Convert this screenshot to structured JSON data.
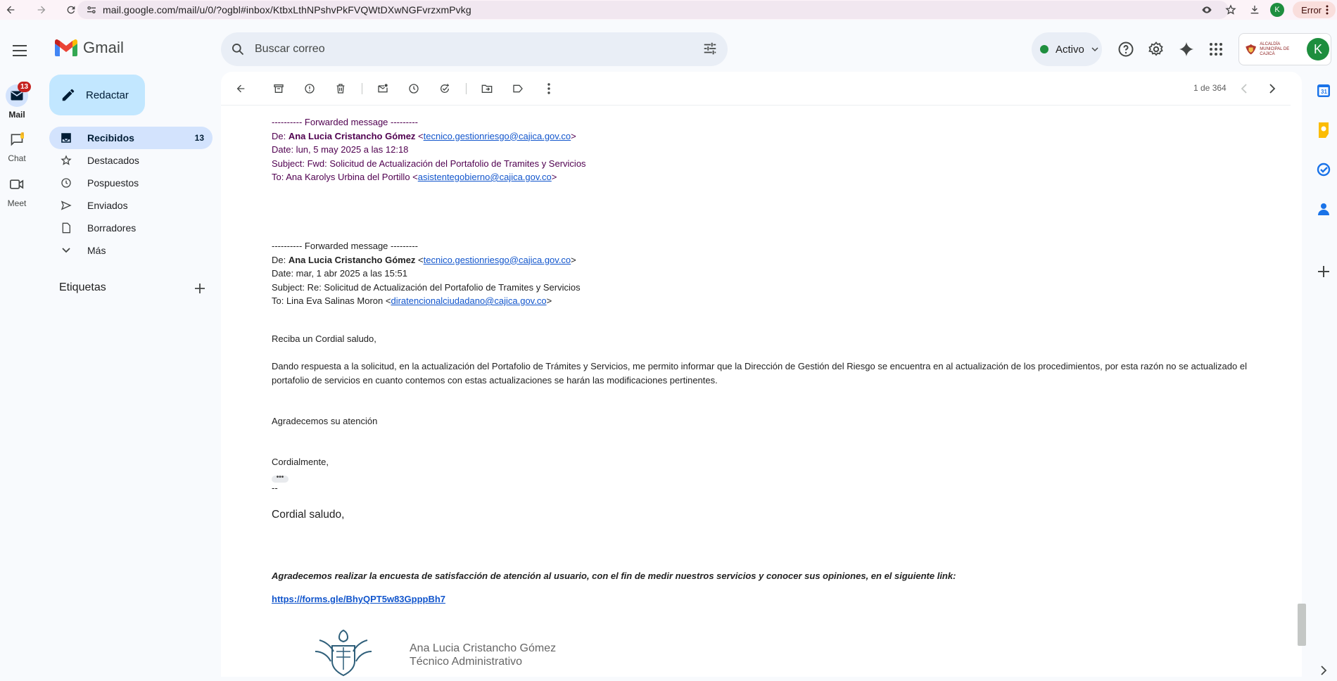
{
  "browser": {
    "url": "mail.google.com/mail/u/0/?ogbl#inbox/KtbxLthNPshvPkFVQWtDXwNGFvrzxmPvkg",
    "profile_initial": "K",
    "error_label": "Error"
  },
  "app": {
    "name": "Gmail",
    "search_placeholder": "Buscar correo",
    "status": "Activo",
    "avatar_initial": "K",
    "org_logo_text": "ALCALDÍA MUNICIPAL DE CAJICÁ"
  },
  "rail": {
    "mail_label": "Mail",
    "mail_badge": "13",
    "chat_label": "Chat",
    "meet_label": "Meet"
  },
  "nav": {
    "compose_label": "Redactar",
    "items": [
      {
        "label": "Recibidos",
        "count": "13",
        "icon": "inbox-icon"
      },
      {
        "label": "Destacados",
        "count": "",
        "icon": "star-icon"
      },
      {
        "label": "Pospuestos",
        "count": "",
        "icon": "clock-icon"
      },
      {
        "label": "Enviados",
        "count": "",
        "icon": "send-icon"
      },
      {
        "label": "Borradores",
        "count": "",
        "icon": "draft-icon"
      },
      {
        "label": "Más",
        "count": "",
        "icon": "chevron-down-icon"
      }
    ],
    "labels_heading": "Etiquetas"
  },
  "toolbar": {
    "pager_text": "1 de 364"
  },
  "message": {
    "fwd1": {
      "header": "---------- Forwarded message ---------",
      "from_prefix": "De: ",
      "from_name": "Ana Lucia Cristancho Gómez",
      "from_email": "tecnico.gestionriesgo@cajica.gov.co",
      "date": "Date: lun, 5 may 2025 a las 12:18",
      "subject": "Subject: Fwd: Solicitud de Actualización del Portafolio de Tramites y Servicios",
      "to_prefix": "To: Ana Karolys Urbina del Portillo <",
      "to_email": "asistentegobierno@cajica.gov.co"
    },
    "fwd2": {
      "header": "---------- Forwarded message ---------",
      "from_prefix": "De: ",
      "from_name": "Ana Lucia Cristancho Gómez",
      "from_email": "tecnico.gestionriesgo@cajica.gov.co",
      "date": "Date: mar, 1 abr 2025 a las 15:51",
      "subject": "Subject: Re: Solicitud de Actualización del Portafolio de Tramites y Servicios",
      "to_prefix": "To: Lina Eva Salinas Moron <",
      "to_email": "diratencionalciudadano@cajica.gov.co"
    },
    "greeting": "Reciba un Cordial saludo,",
    "body_line1": "Dando respuesta a la solicitud, en la actualización del Portafolio de Trámites y Servicios, me permito informar que la Dirección de Gestión del Riesgo se encuentra en al actualización de los procedimientos, por esta razón no se actualizado el",
    "body_line2": "portafolio de servicios en cuanto contemos con estas actualizaciones se harán las modificaciones pertinentes.",
    "thanks": "Agradecemos su atención",
    "closing": "Cordialmente,",
    "sig_dash": "--",
    "cordial": "Cordial saludo,",
    "survey": "Agradecemos realizar la encuesta de satisfacción de atención al usuario, con el fin de medir nuestros servicios y conocer sus opiniones, en el siguiente link:",
    "survey_link": "https://forms.gle/BhyQPT5w83GpppBh7",
    "sig_name": "Ana Lucia Cristancho Gómez",
    "sig_title": "Técnico Administrativo"
  }
}
